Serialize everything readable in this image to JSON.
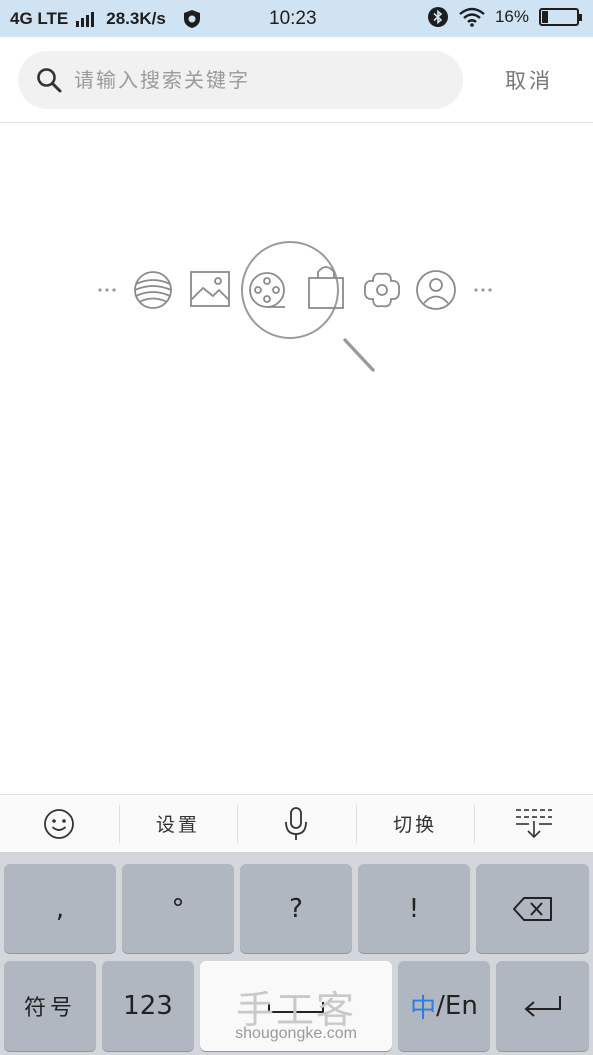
{
  "status_bar": {
    "network": "4G LTE",
    "speed": "28.3K/s",
    "time": "10:23",
    "battery_percent": "16%",
    "battery_level": 0.16,
    "icons": [
      "signal-icon",
      "shield-icon",
      "bluetooth-icon",
      "wifi-icon",
      "battery-icon"
    ]
  },
  "search": {
    "placeholder": "请输入搜索关键字",
    "value": "",
    "cancel_label": "取消"
  },
  "illustration": {
    "dots_left": "···",
    "dots_right": "···",
    "icons": [
      "yarn-ball-icon",
      "picture-icon",
      "film-reel-icon",
      "shopping-bag-icon",
      "flower-icon",
      "user-icon",
      "magnifier-icon"
    ]
  },
  "keyboard_toolbar": {
    "emoji_icon": "smiley-icon",
    "settings_label": "设置",
    "mic_icon": "microphone-icon",
    "switch_label": "切换",
    "collapse_icon": "keyboard-hide-icon"
  },
  "keyboard": {
    "row1": [
      ",",
      "°",
      "?",
      "!"
    ],
    "delete_icon": "backspace-icon",
    "symbols_label": "符号",
    "numbers_label": "123",
    "space_watermark_big": "手工客",
    "space_watermark_small": "shougongke.com",
    "lang_zh": "中",
    "lang_en": "/En",
    "enter_icon": "enter-icon"
  },
  "colors": {
    "status_bar_bg": "#cfe3f3",
    "key_bg": "#b0b7c1",
    "keyboard_bg": "#d3d6db",
    "accent_zh": "#2f7de1"
  }
}
